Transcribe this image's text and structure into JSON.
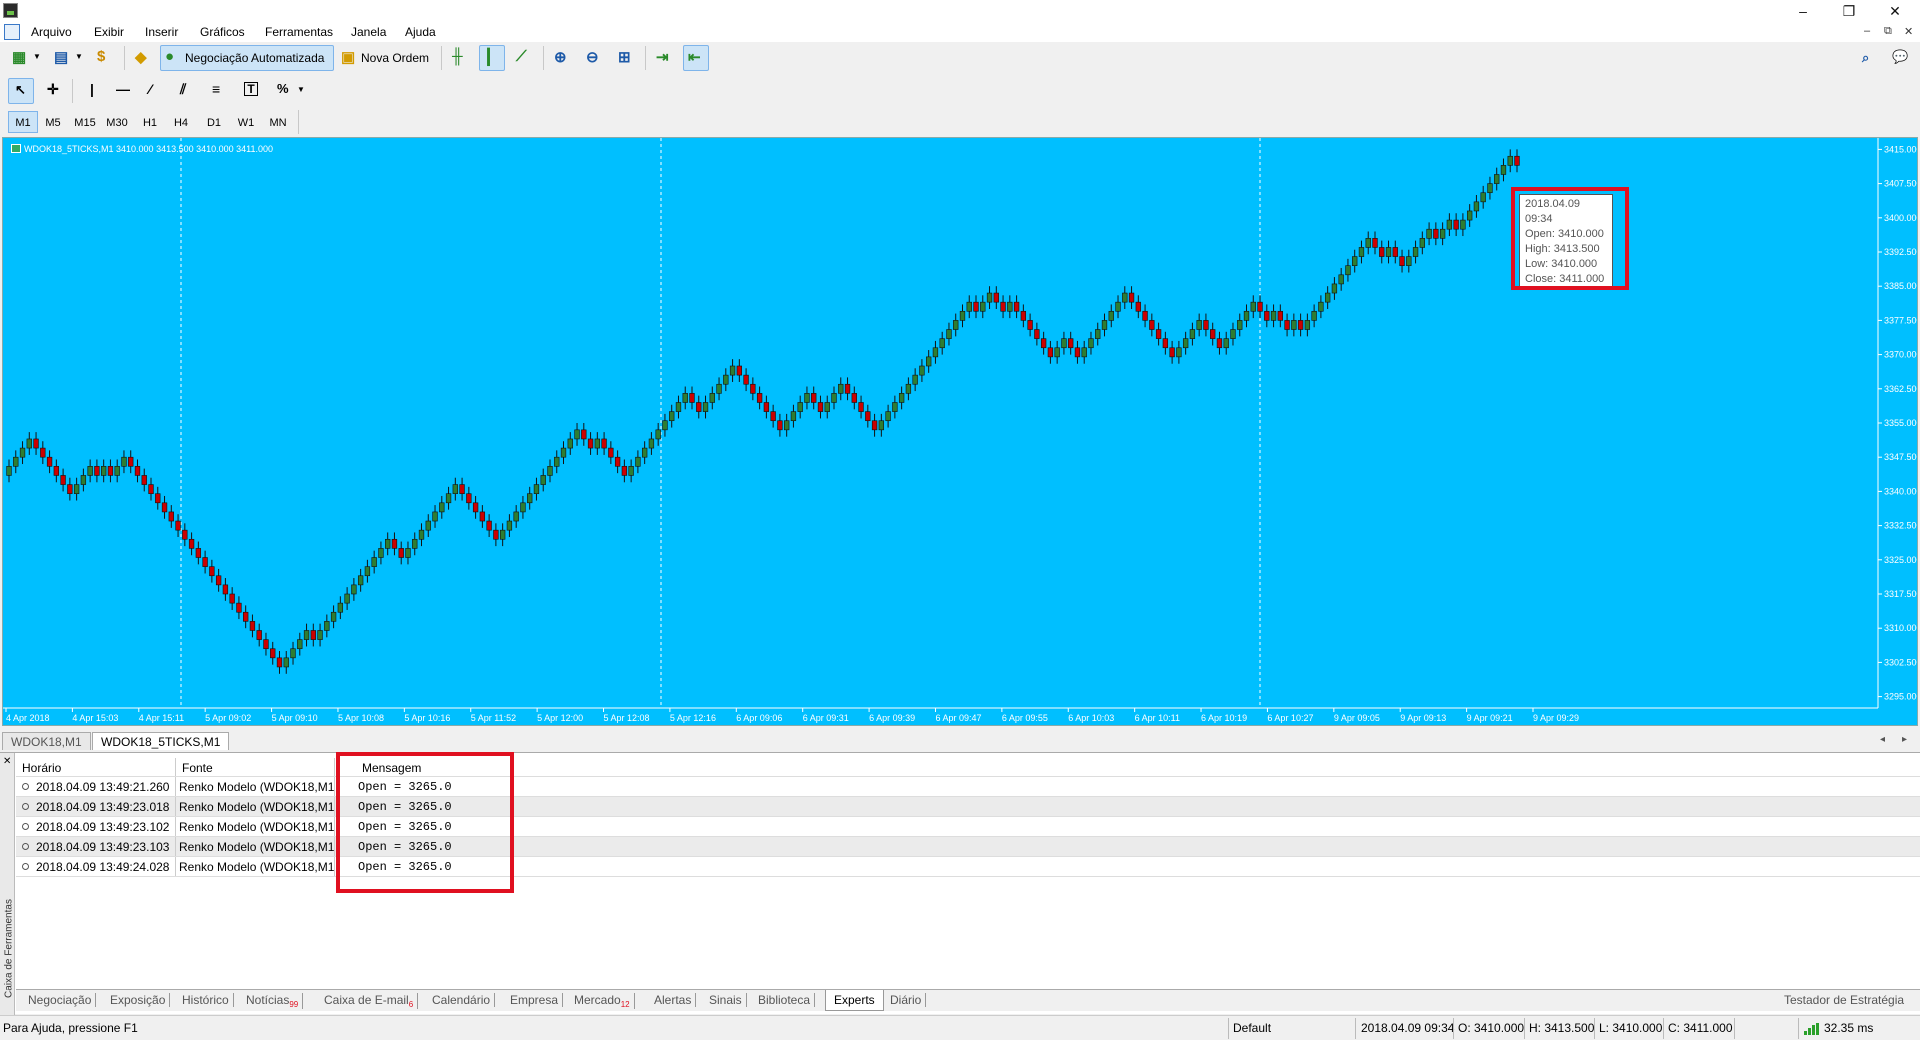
{
  "menu": {
    "items": [
      "Arquivo",
      "Exibir",
      "Inserir",
      "Gráficos",
      "Ferramentas",
      "Janela",
      "Ajuda"
    ]
  },
  "toolbar": {
    "auto_trading_label": "Negociação Automatizada",
    "new_order_label": "Nova Ordem"
  },
  "timeframes": [
    "M1",
    "M5",
    "M15",
    "M30",
    "H1",
    "H4",
    "D1",
    "W1",
    "MN"
  ],
  "chart": {
    "header": "WDOK18_5TICKS,M1  3410.000 3413.500 3410.000 3411.000",
    "background": "#00bfff",
    "bull_color": "#2e7d32",
    "bear_color": "#cc0000",
    "tooltip": {
      "time": "2018.04.09 09:34",
      "open": "Open: 3410.000",
      "high": "High: 3413.500",
      "low": "Low: 3410.000",
      "close": "Close: 3411.000"
    }
  },
  "chart_data": {
    "type": "candlestick",
    "symbol": "WDOK18_5TICKS,M1",
    "ylim": [
      3292.5,
      3417.5
    ],
    "y_ticks": [
      "3415.000",
      "3407.500",
      "3400.000",
      "3392.500",
      "3385.000",
      "3377.500",
      "3370.000",
      "3362.500",
      "3355.000",
      "3347.500",
      "3340.000",
      "3332.500",
      "3325.000",
      "3317.500",
      "3310.000",
      "3302.500",
      "3295.000"
    ],
    "x_ticks": [
      "4 Apr 2018",
      "4 Apr 15:03",
      "4 Apr 15:11",
      "5 Apr 09:02",
      "5 Apr 09:10",
      "5 Apr 10:08",
      "5 Apr 10:16",
      "5 Apr 11:52",
      "5 Apr 12:00",
      "5 Apr 12:08",
      "5 Apr 12:16",
      "6 Apr 09:06",
      "6 Apr 09:31",
      "6 Apr 09:39",
      "6 Apr 09:47",
      "6 Apr 09:55",
      "6 Apr 10:03",
      "6 Apr 10:11",
      "6 Apr 10:19",
      "6 Apr 10:27",
      "9 Apr 09:05",
      "9 Apr 09:13",
      "9 Apr 09:21",
      "9 Apr 09:29"
    ],
    "closes": [
      3345.5,
      3347.5,
      3349.5,
      3351.5,
      3349.5,
      3347.5,
      3345.5,
      3343.5,
      3341.5,
      3339.5,
      3341.5,
      3343.5,
      3345.5,
      3343.5,
      3345.5,
      3343.5,
      3345.5,
      3347.5,
      3345.5,
      3343.5,
      3341.5,
      3339.5,
      3337.5,
      3335.5,
      3333.5,
      3331.5,
      3329.5,
      3327.5,
      3325.5,
      3323.5,
      3321.5,
      3319.5,
      3317.5,
      3315.5,
      3313.5,
      3311.5,
      3309.5,
      3307.5,
      3305.5,
      3303.5,
      3301.5,
      3303.5,
      3305.5,
      3307.5,
      3309.5,
      3307.5,
      3309.5,
      3311.5,
      3313.5,
      3315.5,
      3317.5,
      3319.5,
      3321.5,
      3323.5,
      3325.5,
      3327.5,
      3329.5,
      3327.5,
      3325.5,
      3327.5,
      3329.5,
      3331.5,
      3333.5,
      3335.5,
      3337.5,
      3339.5,
      3341.5,
      3339.5,
      3337.5,
      3335.5,
      3333.5,
      3331.5,
      3329.5,
      3331.5,
      3333.5,
      3335.5,
      3337.5,
      3339.5,
      3341.5,
      3343.5,
      3345.5,
      3347.5,
      3349.5,
      3351.5,
      3353.5,
      3351.5,
      3349.5,
      3351.5,
      3349.5,
      3347.5,
      3345.5,
      3343.5,
      3345.5,
      3347.5,
      3349.5,
      3351.5,
      3353.5,
      3355.5,
      3357.5,
      3359.5,
      3361.5,
      3359.5,
      3357.5,
      3359.5,
      3361.5,
      3363.5,
      3365.5,
      3367.5,
      3365.5,
      3363.5,
      3361.5,
      3359.5,
      3357.5,
      3355.5,
      3353.5,
      3355.5,
      3357.5,
      3359.5,
      3361.5,
      3359.5,
      3357.5,
      3359.5,
      3361.5,
      3363.5,
      3361.5,
      3359.5,
      3357.5,
      3355.5,
      3353.5,
      3355.5,
      3357.5,
      3359.5,
      3361.5,
      3363.5,
      3365.5,
      3367.5,
      3369.5,
      3371.5,
      3373.5,
      3375.5,
      3377.5,
      3379.5,
      3381.5,
      3379.5,
      3381.5,
      3383.5,
      3381.5,
      3379.5,
      3381.5,
      3379.5,
      3377.5,
      3375.5,
      3373.5,
      3371.5,
      3369.5,
      3371.5,
      3373.5,
      3371.5,
      3369.5,
      3371.5,
      3373.5,
      3375.5,
      3377.5,
      3379.5,
      3381.5,
      3383.5,
      3381.5,
      3379.5,
      3377.5,
      3375.5,
      3373.5,
      3371.5,
      3369.5,
      3371.5,
      3373.5,
      3375.5,
      3377.5,
      3375.5,
      3373.5,
      3371.5,
      3373.5,
      3375.5,
      3377.5,
      3379.5,
      3381.5,
      3379.5,
      3377.5,
      3379.5,
      3377.5,
      3375.5,
      3377.5,
      3375.5,
      3377.5,
      3379.5,
      3381.5,
      3383.5,
      3385.5,
      3387.5,
      3389.5,
      3391.5,
      3393.5,
      3395.5,
      3393.5,
      3391.5,
      3393.5,
      3391.5,
      3389.5,
      3391.5,
      3393.5,
      3395.5,
      3397.5,
      3395.5,
      3397.5,
      3399.5,
      3397.5,
      3399.5,
      3401.5,
      3403.5,
      3405.5,
      3407.5,
      3409.5,
      3411.5,
      3413.5,
      3411.5
    ],
    "note": "closes approximated from the visible candle path (5-tick renko-like bricks)"
  },
  "tool_tabs": {
    "chart_tabs": [
      "WDOK18,M1",
      "WDOK18_5TICKS,M1"
    ]
  },
  "journal": {
    "headers": [
      "Horário",
      "Fonte",
      "Mensagem"
    ],
    "rows": [
      {
        "time": "2018.04.09 13:49:21.260",
        "source": "Renko Modelo (WDOK18,M1)",
        "message": "Open = 3265.0"
      },
      {
        "time": "2018.04.09 13:49:23.018",
        "source": "Renko Modelo (WDOK18,M1)",
        "message": "Open = 3265.0"
      },
      {
        "time": "2018.04.09 13:49:23.102",
        "source": "Renko Modelo (WDOK18,M1)",
        "message": "Open = 3265.0"
      },
      {
        "time": "2018.04.09 13:49:23.103",
        "source": "Renko Modelo (WDOK18,M1)",
        "message": "Open = 3265.0"
      },
      {
        "time": "2018.04.09 13:49:24.028",
        "source": "Renko Modelo (WDOK18,M1)",
        "message": "Open = 3265.0"
      }
    ],
    "side_label": "Caixa de Ferramentas"
  },
  "bottom_tabs": [
    {
      "label": "Negociação",
      "badge": ""
    },
    {
      "label": "Exposição",
      "badge": ""
    },
    {
      "label": "Histórico",
      "badge": ""
    },
    {
      "label": "Notícias",
      "badge": "99"
    },
    {
      "label": "Caixa de E-mail",
      "badge": "6"
    },
    {
      "label": "Calendário",
      "badge": ""
    },
    {
      "label": "Empresa",
      "badge": ""
    },
    {
      "label": "Mercado",
      "badge": "12"
    },
    {
      "label": "Alertas",
      "badge": ""
    },
    {
      "label": "Sinais",
      "badge": ""
    },
    {
      "label": "Biblioteca",
      "badge": ""
    },
    {
      "label": "Experts",
      "badge": ""
    },
    {
      "label": "Diário",
      "badge": ""
    }
  ],
  "strategy_tester_label": "Testador de Estratégia",
  "status": {
    "help": "Para Ajuda, pressione F1",
    "profile": "Default",
    "time": "2018.04.09 09:34",
    "open": "O: 3410.000",
    "high": "H: 3413.500",
    "low": "L: 3410.000",
    "close": "C: 3411.000",
    "ping": "32.35 ms"
  }
}
